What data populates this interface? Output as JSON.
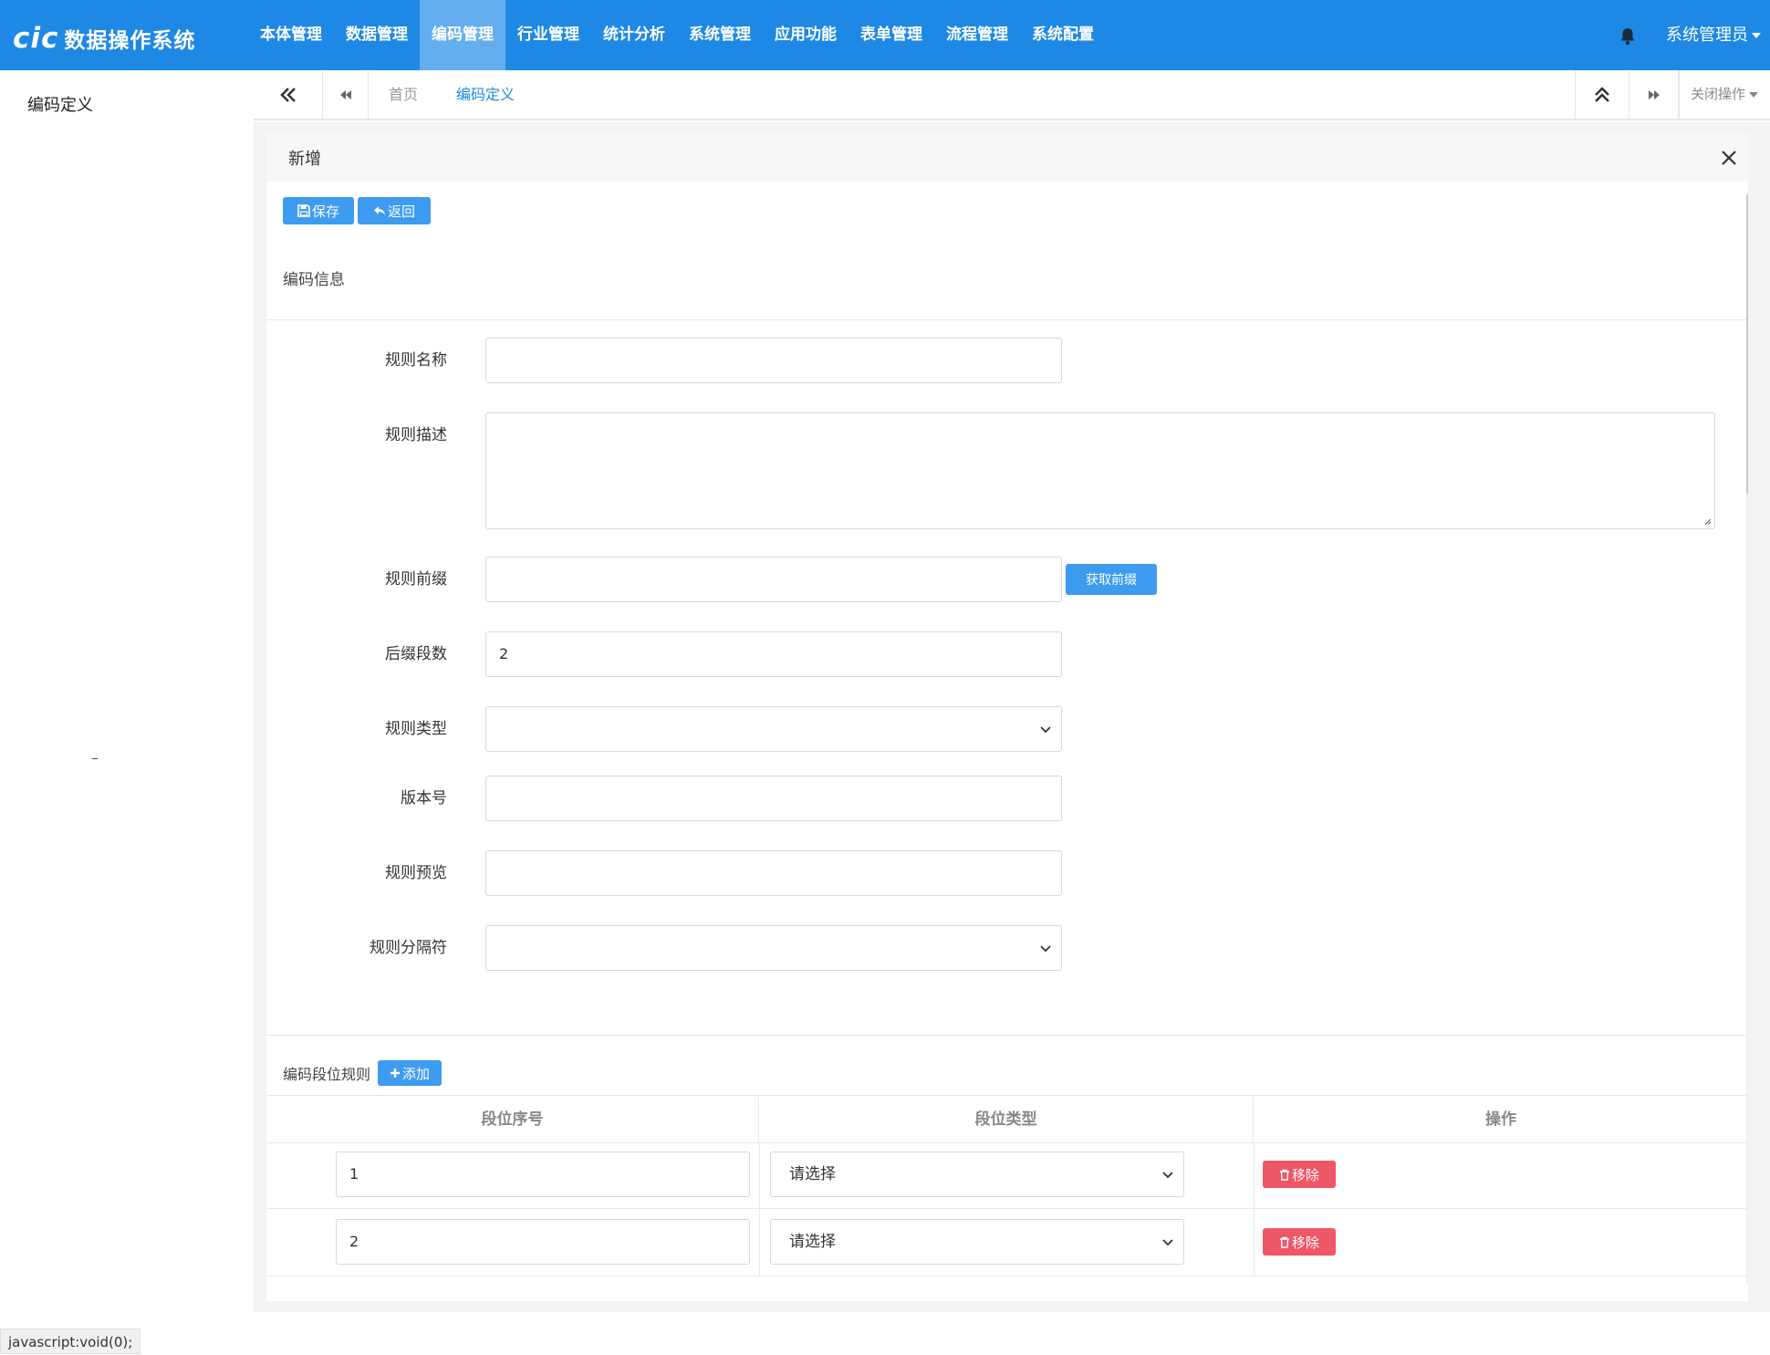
{
  "header": {
    "logo_mark": "cic",
    "logo_text": "数据操作系统",
    "menu": [
      {
        "label": "本体管理"
      },
      {
        "label": "数据管理"
      },
      {
        "label": "编码管理"
      },
      {
        "label": "行业管理"
      },
      {
        "label": "统计分析"
      },
      {
        "label": "系统管理"
      },
      {
        "label": "应用功能"
      },
      {
        "label": "表单管理"
      },
      {
        "label": "流程管理"
      },
      {
        "label": "系统配置"
      }
    ],
    "active_menu": "编码管理",
    "user": "系统管理员",
    "accent_color": "#1e88e5"
  },
  "sidebar": {
    "title": "编码定义",
    "dash": "–"
  },
  "tabs": {
    "items": [
      {
        "label": "首页"
      },
      {
        "label": "编码定义"
      }
    ],
    "close_ops": "关闭操作"
  },
  "panel": {
    "title": "新增",
    "save_label": "保存",
    "back_label": "返回",
    "section_info": "编码信息",
    "fields": {
      "rule_name": {
        "label": "规则名称",
        "value": ""
      },
      "rule_desc": {
        "label": "规则描述",
        "value": ""
      },
      "rule_prefix": {
        "label": "规则前缀",
        "value": "",
        "button": "获取前缀"
      },
      "suffix_count": {
        "label": "后缀段数",
        "value": "2"
      },
      "rule_type": {
        "label": "规则类型",
        "value": ""
      },
      "version": {
        "label": "版本号",
        "value": ""
      },
      "rule_preview": {
        "label": "规则预览",
        "value": ""
      },
      "rule_separator": {
        "label": "规则分隔符",
        "value": ""
      }
    },
    "section_segments": "编码段位规则",
    "add_label": "添加",
    "table": {
      "headers": [
        "段位序号",
        "段位类型",
        "操作"
      ],
      "rows": [
        {
          "seq": "1",
          "type": "请选择",
          "action": "移除"
        },
        {
          "seq": "2",
          "type": "请选择",
          "action": "移除"
        }
      ]
    }
  },
  "statusbar": "javascript:void(0);"
}
